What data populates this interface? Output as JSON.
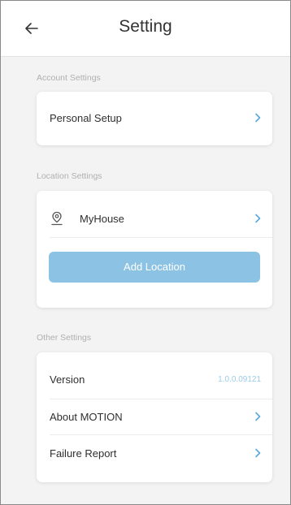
{
  "header": {
    "title": "Setting",
    "back_icon": "arrow-left-icon"
  },
  "account_section": {
    "label": "Account Settings",
    "items": [
      {
        "label": "Personal Setup",
        "icon": "chevron-right-icon"
      }
    ]
  },
  "location_section": {
    "label": "Location Settings",
    "location": {
      "label": "MyHouse",
      "icon": "location-pin-icon"
    },
    "add_button_label": "Add Location"
  },
  "other_section": {
    "label": "Other Settings",
    "version": {
      "label": "Version",
      "value": "1.0.0.09121"
    },
    "about": {
      "label": "About MOTION"
    },
    "failure": {
      "label": "Failure Report"
    }
  },
  "colors": {
    "accent": "#5aa8de",
    "button": "#8cc3e4",
    "background": "#f3f3f3"
  }
}
